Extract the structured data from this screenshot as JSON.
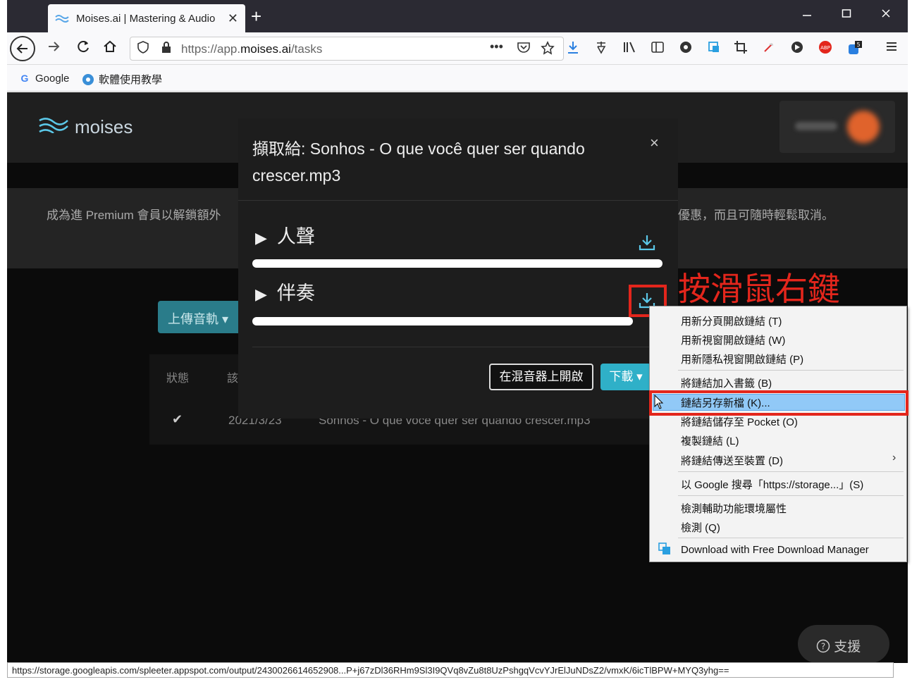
{
  "browser": {
    "tab_title": "Moises.ai | Mastering & Audio",
    "tab_close": "✕",
    "new_tab": "+",
    "url_prefix": "https://app.",
    "url_domain": "moises.ai",
    "url_path": "/tasks",
    "bookmarks": [
      "Google",
      "軟體使用教學"
    ]
  },
  "page": {
    "logo_text": "moises",
    "banner_left": "成為進 Premium 會員以解鎖額外",
    "banner_right": "優惠，而且可隨時輕鬆取消。",
    "upload_label": "上傳音軌",
    "table_status_header": "狀態",
    "table_title_header": "該",
    "row_check": "✔",
    "row_date": "2021/3/23",
    "row_name": "Sonhos - O que você quer ser quando crescer.mp3",
    "support_label": "支援"
  },
  "modal": {
    "title": "擷取給: Sonhos - O que você quer ser quando crescer.mp3",
    "close": "×",
    "tracks": [
      {
        "label": "人聲"
      },
      {
        "label": "伴奏"
      }
    ],
    "open_mixer": "在混音器上開啟",
    "download": "下載"
  },
  "annotation": {
    "text": "按滑鼠右鍵",
    "color": "#e3261c"
  },
  "context_menu": {
    "items": [
      "用新分頁開啟鏈結 (T)",
      "用新視窗開啟鏈結 (W)",
      "用新隱私視窗開啟鏈結 (P)",
      "將鏈結加入書籤 (B)",
      "鏈結另存新檔 (K)...",
      "將鏈結儲存至 Pocket (O)",
      "複製鏈結 (L)",
      "將鏈結傳送至裝置 (D)",
      "以 Google 搜尋「https://storage...」(S)",
      "檢測輔助功能環境屬性",
      "檢測 (Q)",
      "Download with Free Download Manager"
    ],
    "highlight_color": "#91c9f7"
  },
  "status_bar": {
    "url": "https://storage.googleapis.com/spleeter.appspot.com/output/2430026614652908...P+j67zDl36RHm9Sl3I9QVq8vZu8t8UzPshgqVcvYJrElJuNDsZ2/vmxK/6icTlBPW+MYQ3yhg=="
  },
  "colors": {
    "accent": "#2fb0c8",
    "page_bg": "#0b0b0b",
    "modal_bg": "#1d1d1d"
  }
}
